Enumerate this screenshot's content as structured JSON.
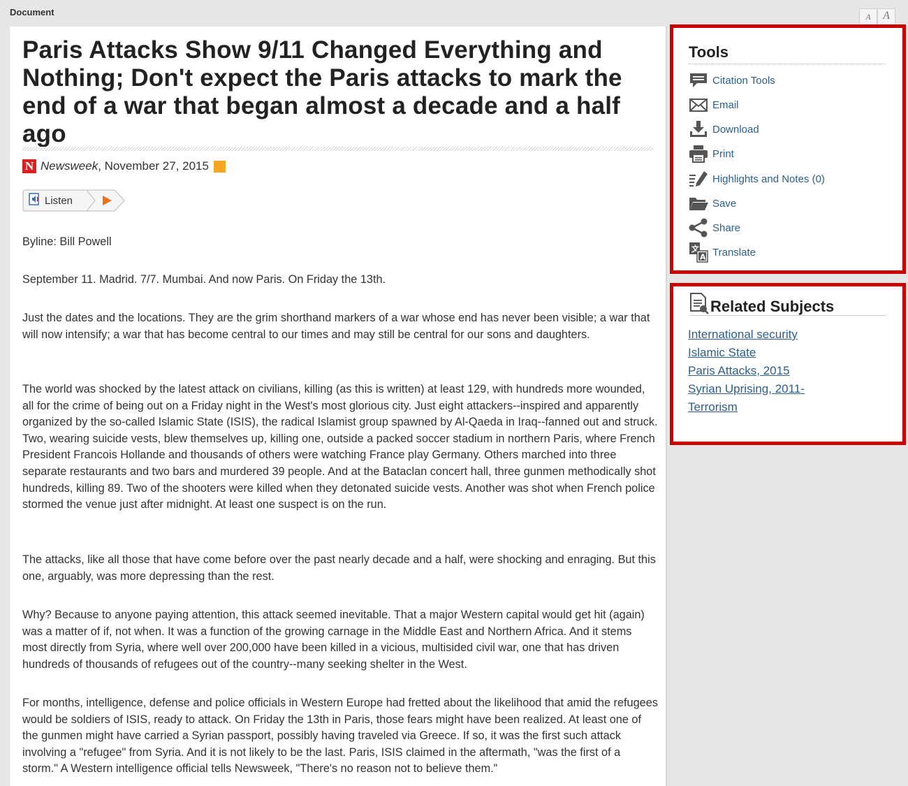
{
  "header": {
    "document_label": "Document",
    "font_small": "A",
    "font_large": "A"
  },
  "article": {
    "title": "Paris Attacks Show 9/11 Changed Everything and Nothing; Don't expect the Paris attacks to mark the end of a war that began almost a decade and a half ago",
    "source_logo": "N",
    "source_name": "Newsweek",
    "date": ", November 27, 2015",
    "listen_label": "Listen",
    "paragraphs": [
      "Byline: Bill Powell",
      "September 11. Madrid. 7/7. Mumbai. And now Paris. On Friday the 13th.",
      "Just the dates and the locations. They are the grim shorthand markers of a war whose end has never been visible; a war that will now intensify; a war that has become central to our times and may still be central for our sons and daughters.",
      "The world was shocked by the latest attack on civilians, killing (as this is written) at least 129, with hundreds more wounded, all for the crime of being out on a Friday night in the West's most glorious city. Just eight attackers--inspired and apparently organized by the so-called Islamic State (ISIS), the radical Islamist group spawned by Al-Qaeda in Iraq--fanned out and struck. Two, wearing suicide vests, blew themselves up, killing one, outside a packed soccer stadium in northern Paris, where French President Francois Hollande and thousands of others were watching France play Germany. Others marched into three separate restaurants and two bars and murdered 39 people. And at the Bataclan concert hall, three gunmen methodically shot hundreds, killing 89. Two of the shooters were killed when they detonated suicide vests. Another was shot when French police stormed the venue just after midnight. At least one suspect is on the run.",
      "The attacks, like all those that have come before over the past nearly decade and a half, were shocking and enraging. But this one, arguably, was more depressing than the rest.",
      "Why? Because to anyone paying attention, this attack seemed inevitable. That a major Western capital would get hit (again) was a matter of if, not when. It was a function of the growing carnage in the Middle East and Northern Africa. And it stems most directly from Syria, where well over 200,000 have been killed in a vicious, multisided civil war, one that has driven hundreds of thousands of refugees out of the country--many seeking shelter in the West.",
      "For months, intelligence, defense and police officials in Western Europe had fretted about the likelihood that amid the refugees would be soldiers of ISIS, ready to attack. On Friday the 13th in Paris, those fears might have been realized. At least one of the gunmen might have carried a Syrian passport, possibly having traveled via Greece. If so, it was the first such attack involving a \"refugee\" from Syria. And it is not likely to be the last. Paris, ISIS claimed in the aftermath, \"was the first of a storm.\" A Western intelligence official tells Newsweek, \"There's no reason not to believe them.\""
    ]
  },
  "tools": {
    "title": "Tools",
    "items": [
      {
        "label": "Citation Tools",
        "icon": "citation-icon"
      },
      {
        "label": "Email",
        "icon": "email-icon"
      },
      {
        "label": "Download",
        "icon": "download-icon"
      },
      {
        "label": "Print",
        "icon": "print-icon"
      },
      {
        "label": "Highlights and Notes (0)",
        "icon": "highlight-icon"
      },
      {
        "label": "Save",
        "icon": "folder-icon"
      },
      {
        "label": "Share",
        "icon": "share-icon"
      },
      {
        "label": "Translate",
        "icon": "translate-icon"
      }
    ]
  },
  "related": {
    "title": "Related Subjects",
    "subjects": [
      "International security",
      "Islamic State",
      "Paris Attacks, 2015",
      "Syrian Uprising, 2011-",
      "Terrorism"
    ]
  },
  "colors": {
    "highlight_border": "#cc0000",
    "link": "#2c5e8e",
    "newsweek_red": "#d9201f",
    "rss_orange": "#f6a623"
  }
}
